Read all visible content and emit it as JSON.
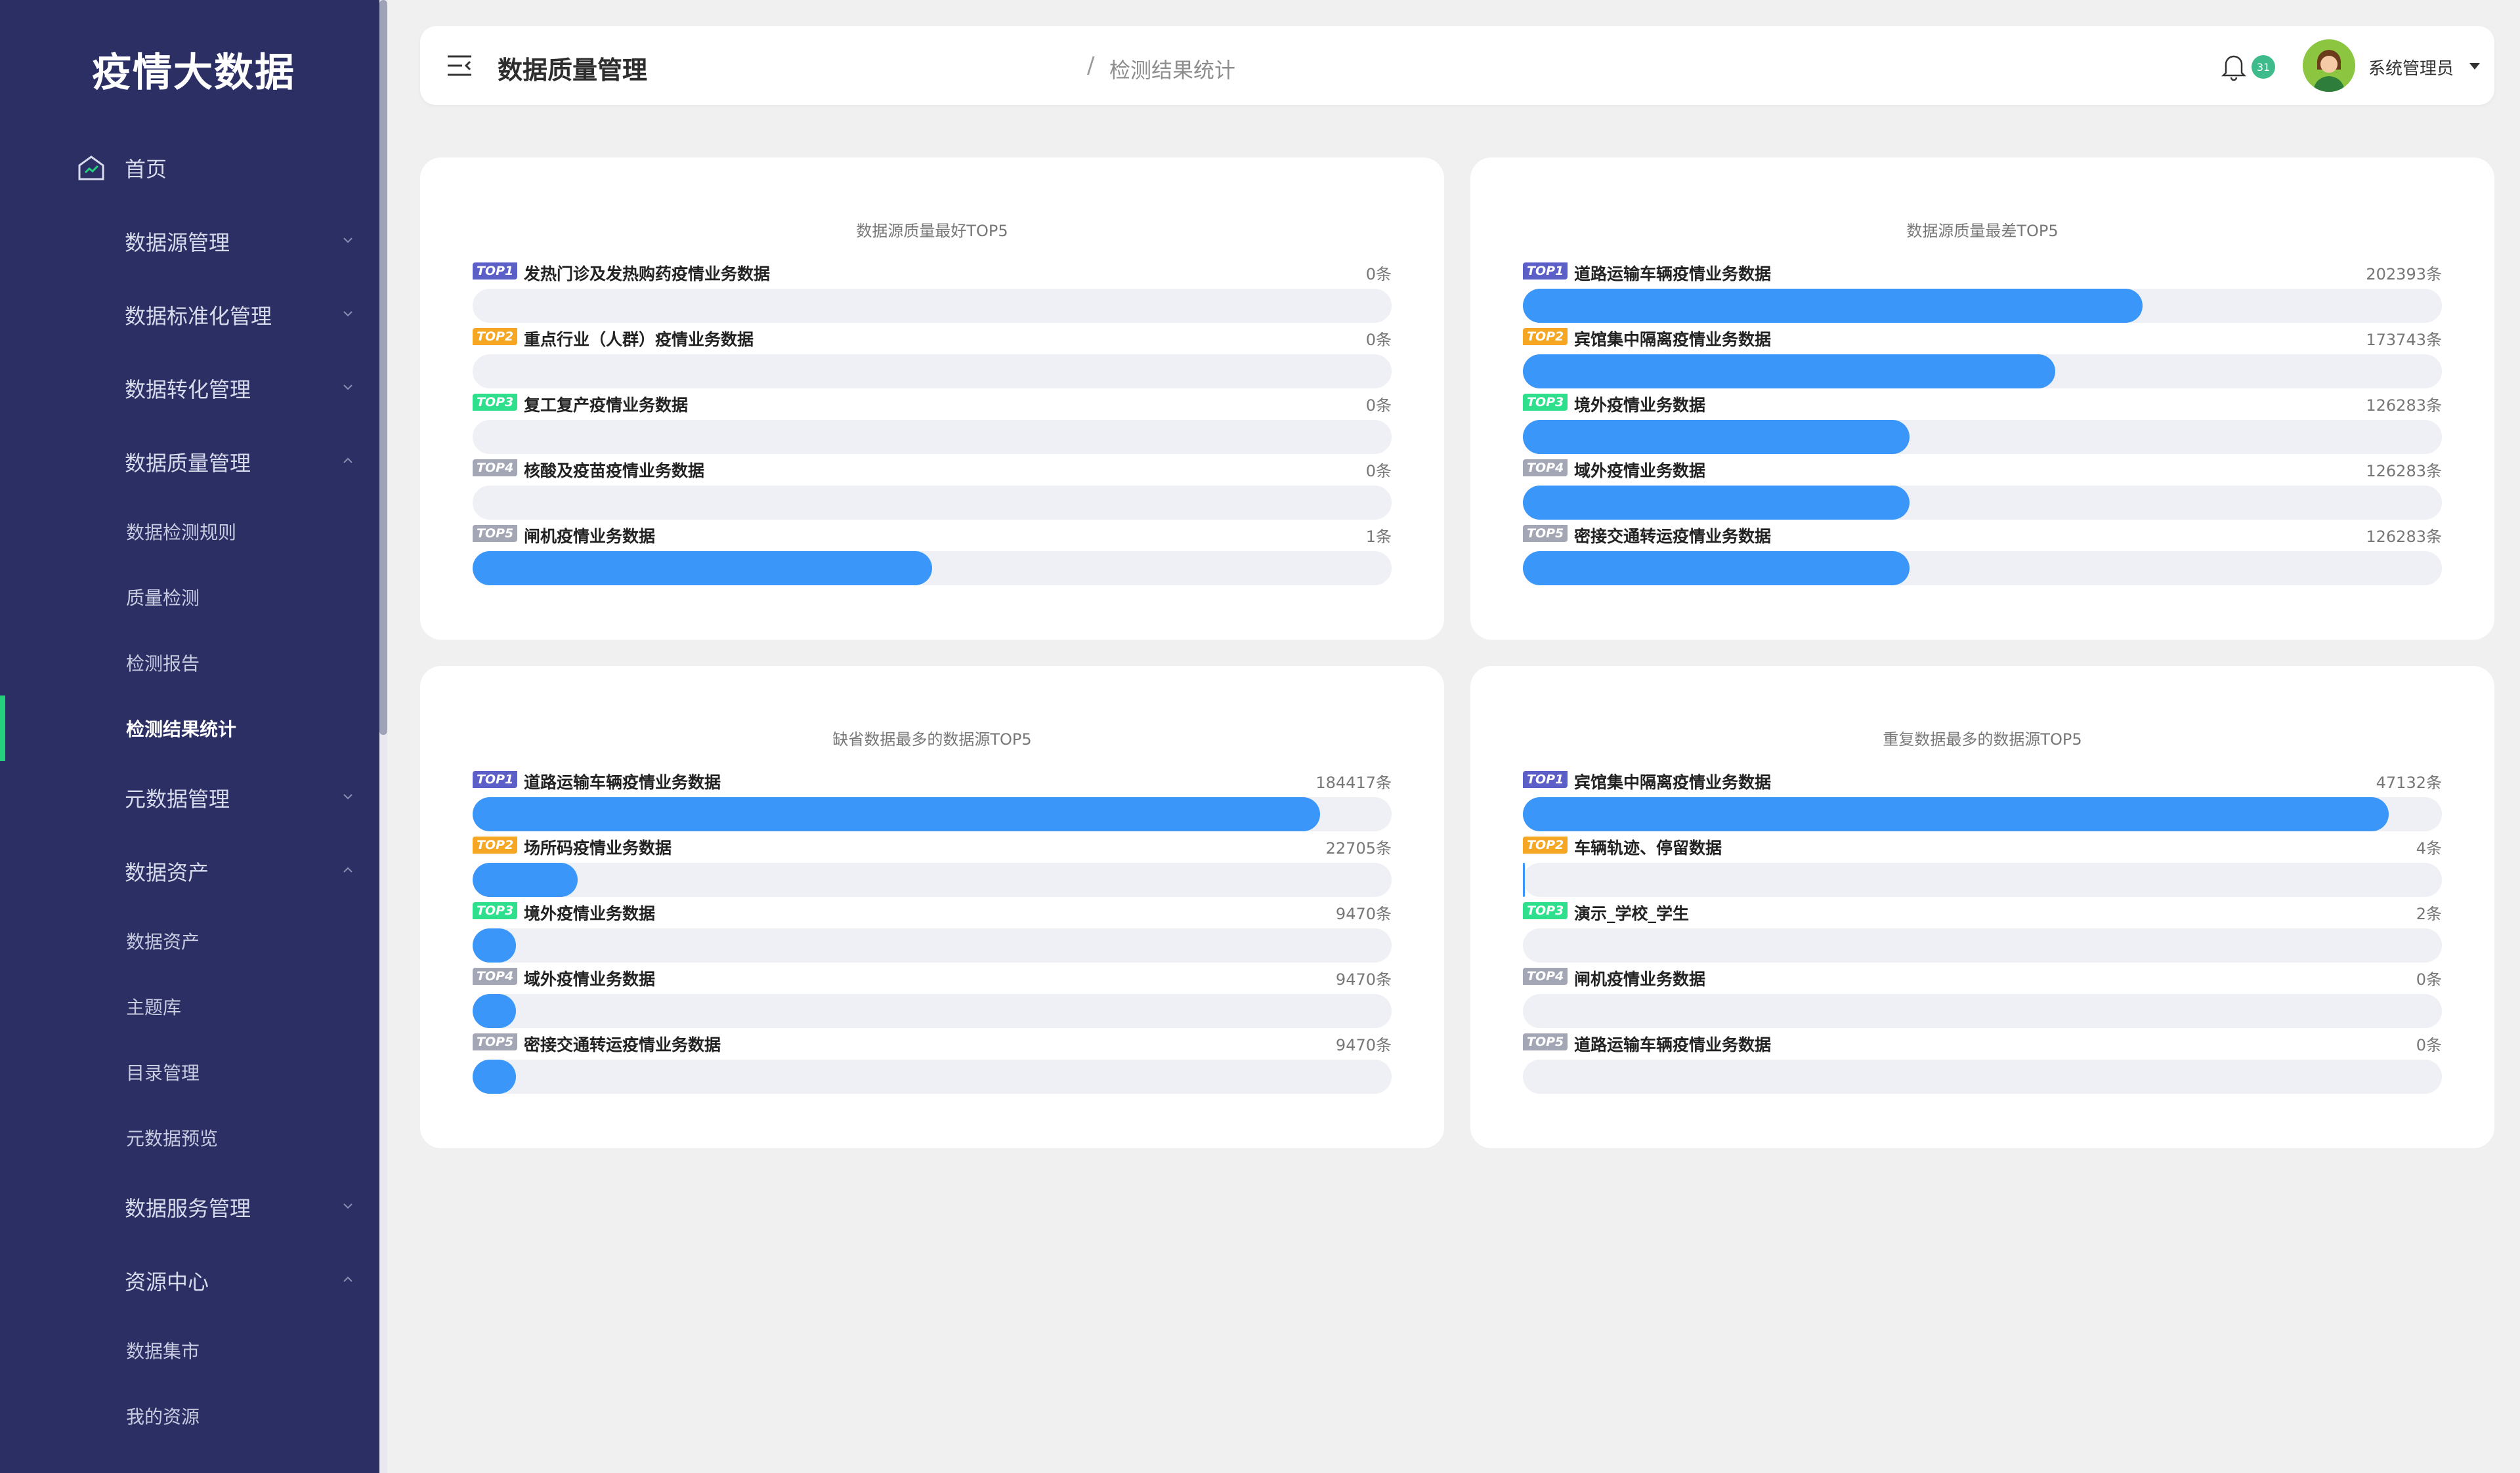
{
  "app": {
    "title": "疫情大数据"
  },
  "sidebar": {
    "items": [
      {
        "label": "首页",
        "icon": "home-icon"
      },
      {
        "label": "数据源管理",
        "icon": "chevron-down-icon"
      },
      {
        "label": "数据标准化管理",
        "icon": "chevron-down-icon"
      },
      {
        "label": "数据转化管理",
        "icon": "chevron-down-icon"
      },
      {
        "label": "数据质量管理",
        "icon": "chevron-up-icon"
      },
      {
        "label": "元数据管理",
        "icon": "chevron-down-icon"
      },
      {
        "label": "数据资产",
        "icon": "chevron-up-icon"
      },
      {
        "label": "数据服务管理",
        "icon": "chevron-down-icon"
      },
      {
        "label": "资源中心",
        "icon": "chevron-up-icon"
      }
    ],
    "quality_sub": [
      "数据检测规则",
      "质量检测",
      "检测报告",
      "检测结果统计"
    ],
    "asset_sub": [
      "数据资产",
      "主题库",
      "目录管理",
      "元数据预览"
    ],
    "resource_sub": [
      "数据集市",
      "我的资源"
    ],
    "active": "检测结果统计"
  },
  "header": {
    "breadcrumb_main": "数据质量管理",
    "breadcrumb_sep": "/",
    "breadcrumb_sub": "检测结果统计",
    "notification_count": "31",
    "user_name": "系统管理员"
  },
  "colors": {
    "sidebar_bg": "#2b2f64",
    "bar": "#3a96f8",
    "active_marker": "#25d07d",
    "top1": "#5b5fc7",
    "top2": "#f5a623",
    "top3": "#2ee08c",
    "top45": "#a3a6b5"
  },
  "panels": [
    {
      "title": "数据源质量最好TOP5",
      "rows": [
        {
          "tag": "TOP1",
          "name": "发热门诊及发热购药疫情业务数据",
          "value": "0条",
          "fraction": 0
        },
        {
          "tag": "TOP2",
          "name": "重点行业（人群）疫情业务数据",
          "value": "0条",
          "fraction": 0
        },
        {
          "tag": "TOP3",
          "name": "复工复产疫情业务数据",
          "value": "0条",
          "fraction": 0
        },
        {
          "tag": "TOP4",
          "name": "核酸及疫苗疫情业务数据",
          "value": "0条",
          "fraction": 0
        },
        {
          "tag": "TOP5",
          "name": "闸机疫情业务数据",
          "value": "1条",
          "fraction": 0.5
        }
      ]
    },
    {
      "title": "数据源质量最差TOP5",
      "rows": [
        {
          "tag": "TOP1",
          "name": "道路运输车辆疫情业务数据",
          "value": "202393条",
          "fraction": 0.674
        },
        {
          "tag": "TOP2",
          "name": "宾馆集中隔离疫情业务数据",
          "value": "173743条",
          "fraction": 0.579
        },
        {
          "tag": "TOP3",
          "name": "境外疫情业务数据",
          "value": "126283条",
          "fraction": 0.421
        },
        {
          "tag": "TOP4",
          "name": "域外疫情业务数据",
          "value": "126283条",
          "fraction": 0.421
        },
        {
          "tag": "TOP5",
          "name": "密接交通转运疫情业务数据",
          "value": "126283条",
          "fraction": 0.421
        }
      ]
    },
    {
      "title": "缺省数据最多的数据源TOP5",
      "rows": [
        {
          "tag": "TOP1",
          "name": "道路运输车辆疫情业务数据",
          "value": "184417条",
          "fraction": 0.922
        },
        {
          "tag": "TOP2",
          "name": "场所码疫情业务数据",
          "value": "22705条",
          "fraction": 0.114
        },
        {
          "tag": "TOP3",
          "name": "境外疫情业务数据",
          "value": "9470条",
          "fraction": 0.047
        },
        {
          "tag": "TOP4",
          "name": "域外疫情业务数据",
          "value": "9470条",
          "fraction": 0.047
        },
        {
          "tag": "TOP5",
          "name": "密接交通转运疫情业务数据",
          "value": "9470条",
          "fraction": 0.047
        }
      ]
    },
    {
      "title": "重复数据最多的数据源TOP5",
      "rows": [
        {
          "tag": "TOP1",
          "name": "宾馆集中隔离疫情业务数据",
          "value": "47132条",
          "fraction": 0.942
        },
        {
          "tag": "TOP2",
          "name": "车辆轨迹、停留数据",
          "value": "4条",
          "fraction": 0.002
        },
        {
          "tag": "TOP3",
          "name": "演示_学校_学生",
          "value": "2条",
          "fraction": 0
        },
        {
          "tag": "TOP4",
          "name": "闸机疫情业务数据",
          "value": "0条",
          "fraction": 0
        },
        {
          "tag": "TOP5",
          "name": "道路运输车辆疫情业务数据",
          "value": "0条",
          "fraction": 0
        }
      ]
    }
  ]
}
